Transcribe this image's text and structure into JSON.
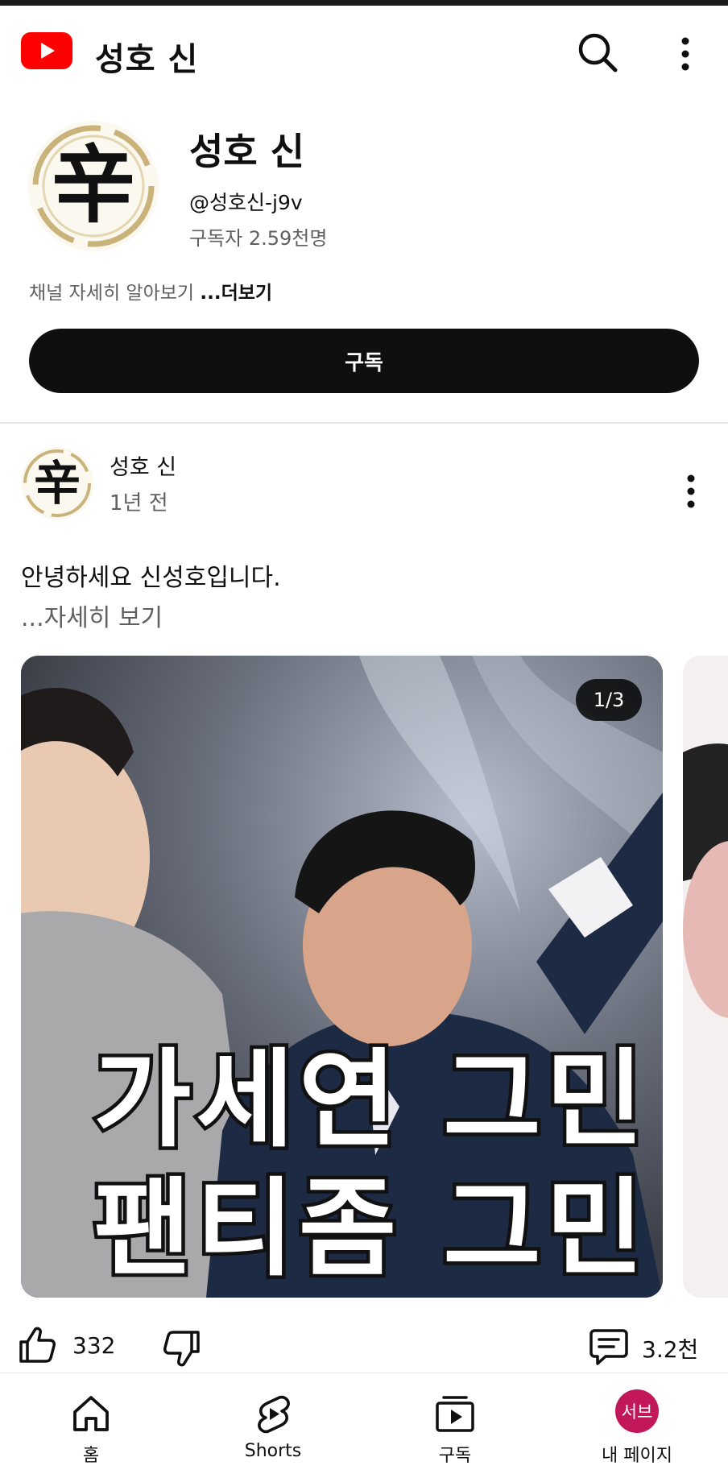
{
  "header": {
    "title": "성호 신",
    "logo_icon": "youtube-logo-icon",
    "search_icon": "search-icon",
    "more_icon": "more-vert-icon"
  },
  "channel": {
    "name": "성호 신",
    "handle": "@성호신-j9v",
    "subscribers": "구독자 2.59천명",
    "about": "채널 자세히 알아보기",
    "about_more": "...더보기",
    "avatar_glyph": "辛",
    "subscribe_label": "구독"
  },
  "post": {
    "author": "성호 신",
    "time": "1년 전",
    "text": "안녕하세요 신성호입니다.",
    "read_more": "...자세히 보기",
    "page_counter": "1/3",
    "image_overlay": [
      "가세연 그민",
      "팬티좀 그민"
    ],
    "likes": "332",
    "comments": "3.2천"
  },
  "nav": {
    "items": [
      {
        "label": "홈",
        "icon": "home-icon"
      },
      {
        "label": "Shorts",
        "icon": "shorts-icon"
      },
      {
        "label": "구독",
        "icon": "subscriptions-icon"
      },
      {
        "label": "내 페이지",
        "icon": "avatar",
        "avatar_text": "서브"
      }
    ]
  },
  "colors": {
    "brand_red": "#ff0000",
    "subscribe_bg": "#0f0f0f",
    "secondary_text": "#606060",
    "nav_avatar": "#c2185b"
  }
}
